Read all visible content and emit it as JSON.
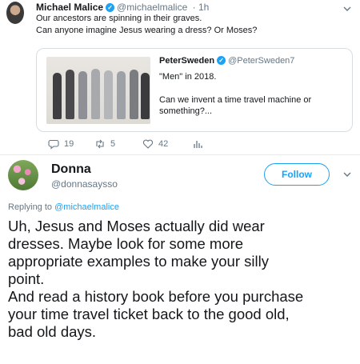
{
  "top_tweet": {
    "name": "Michael Malice",
    "handle": "@michaelmalice",
    "time": "· 1h",
    "line1": "Our ancestors are spinning in their graves.",
    "line2": "Can anyone imagine Jesus wearing a dress? Or Moses?"
  },
  "quoted_tweet": {
    "name": "PeterSweden",
    "handle": "@PeterSweden7",
    "line1": "\"Men\" in 2018.",
    "line2": "Can we invent a time travel machine or something?..."
  },
  "actions": {
    "replies": "19",
    "retweets": "5",
    "likes": "42"
  },
  "reply": {
    "name": "Donna",
    "handle": "@donnasaysso",
    "follow_label": "Follow",
    "replying_prefix": "Replying to",
    "replying_to": "@michaelmalice",
    "text_lines": [
      "Uh, Jesus and Moses actually did wear",
      "dresses. Maybe look for some more",
      "appropriate examples to make your silly",
      "point.",
      "And read a history book before you purchase",
      "your time travel ticket back to the good old,",
      "bad old days."
    ]
  },
  "colors": {
    "accent": "#1da1f2",
    "secondary_text": "#657786",
    "primary_text": "#14171a"
  },
  "icons": [
    "reply-icon",
    "retweet-icon",
    "like-icon",
    "analytics-icon",
    "verified-icon",
    "chevron-down-icon"
  ]
}
